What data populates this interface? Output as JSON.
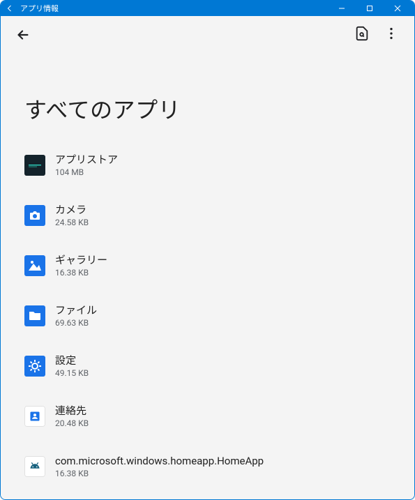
{
  "window": {
    "title": "アプリ情報"
  },
  "page": {
    "title": "すべてのアプリ"
  },
  "apps": [
    {
      "name": "アプリストア",
      "size": "104 MB",
      "icon": "appstore"
    },
    {
      "name": "カメラ",
      "size": "24.58 KB",
      "icon": "camera"
    },
    {
      "name": "ギャラリー",
      "size": "16.38 KB",
      "icon": "gallery"
    },
    {
      "name": "ファイル",
      "size": "69.63 KB",
      "icon": "files"
    },
    {
      "name": "設定",
      "size": "49.15 KB",
      "icon": "settings"
    },
    {
      "name": "連絡先",
      "size": "20.48 KB",
      "icon": "contacts"
    },
    {
      "name": "com.microsoft.windows.homeapp.HomeApp",
      "size": "16.38 KB",
      "icon": "android"
    }
  ]
}
